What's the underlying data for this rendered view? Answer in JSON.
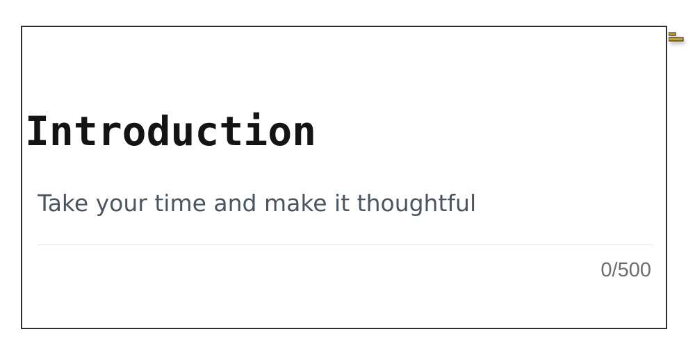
{
  "editor": {
    "title": "Introduction",
    "placeholder": "Take your time and make it thoughtful",
    "value": "",
    "counter": "0/500"
  },
  "icons": {
    "handle": "drag-handle-icon"
  },
  "colors": {
    "border": "#2b2f33",
    "title": "#141414",
    "placeholder": "#4a5560",
    "divider": "#e6e6e6",
    "counter": "#6d6d6d",
    "handle_accent": "#c9a227"
  }
}
